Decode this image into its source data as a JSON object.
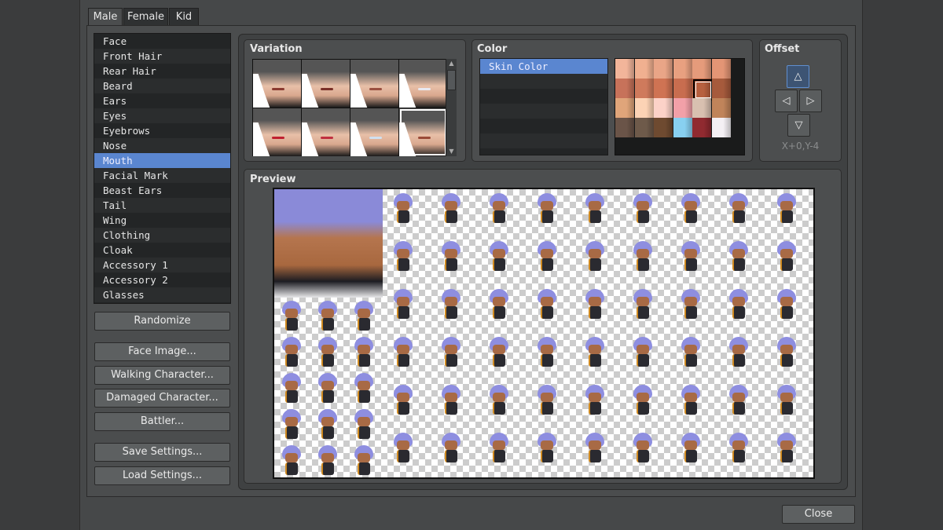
{
  "tabs": [
    {
      "label": "Male"
    },
    {
      "label": "Female"
    },
    {
      "label": "Kid"
    }
  ],
  "active_tab": "Male",
  "parts": [
    "Face",
    "Front Hair",
    "Rear Hair",
    "Beard",
    "Ears",
    "Eyes",
    "Eyebrows",
    "Nose",
    "Mouth",
    "Facial Mark",
    "Beast Ears",
    "Tail",
    "Wing",
    "Clothing",
    "Cloak",
    "Accessory 1",
    "Accessory 2",
    "Glasses"
  ],
  "selected_part": "Mouth",
  "buttons": {
    "randomize": "Randomize",
    "face_image": "Face Image...",
    "walking": "Walking Character...",
    "damaged": "Damaged Character...",
    "battler": "Battler...",
    "save": "Save Settings...",
    "load": "Load Settings...",
    "close": "Close"
  },
  "variation": {
    "title": "Variation",
    "selected_index": 7,
    "count": 8
  },
  "color": {
    "title": "Color",
    "items": [
      "Skin Color"
    ],
    "selected_swatch": 10,
    "swatches": [
      "#f2b59a",
      "#f0b090",
      "#e9a587",
      "#e8a080",
      "#e59b7b",
      "#e39575",
      "#c7725a",
      "#cf7a5c",
      "#cf7353",
      "#c86d4f",
      "#b7603f",
      "#a65a3c",
      "#e0a57a",
      "#fcd3b5",
      "#fcd2c8",
      "#f2a0a8",
      "#d8c0b0",
      "#c0845a",
      "#6a5448",
      "#6e5a4a",
      "#6e4a30",
      "#88d0f0",
      "#902a30",
      "#f4f0f4"
    ]
  },
  "offset": {
    "title": "Offset",
    "up": "△",
    "left": "◁",
    "right": "▷",
    "down": "▽",
    "value": "X+0,Y-4"
  },
  "preview": {
    "title": "Preview"
  }
}
